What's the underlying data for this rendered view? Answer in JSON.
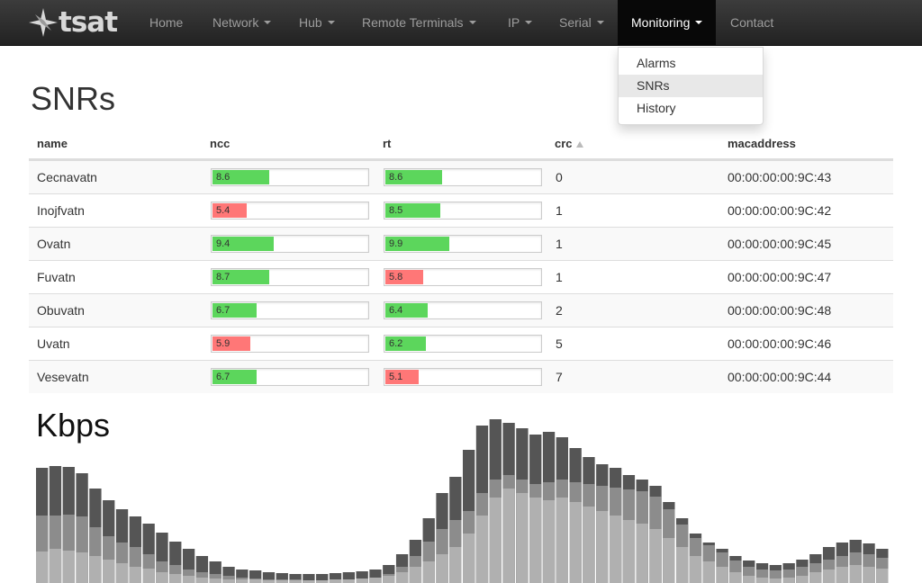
{
  "navbar": {
    "brand": "tsat",
    "items": [
      {
        "label": "Home",
        "caret": false,
        "active": false
      },
      {
        "label": "Network",
        "caret": true,
        "active": false
      },
      {
        "label": "Hub",
        "caret": true,
        "active": false
      },
      {
        "label": "Remote Terminals",
        "caret": true,
        "active": false
      },
      {
        "label": "IP",
        "caret": true,
        "active": false
      },
      {
        "label": "Serial",
        "caret": true,
        "active": false
      },
      {
        "label": "Monitoring",
        "caret": true,
        "active": true
      },
      {
        "label": "Contact",
        "caret": false,
        "active": false
      }
    ],
    "dropdown": [
      {
        "label": "Alarms"
      },
      {
        "label": "SNRs"
      },
      {
        "label": "History"
      }
    ]
  },
  "snr": {
    "title": "SNRs",
    "columns": {
      "name": "name",
      "ncc": "ncc",
      "rt": "rt",
      "crc": "crc",
      "mac": "macaddress"
    },
    "sorted_column": "crc",
    "colors": {
      "ok": "#5cd65c",
      "bad": "#ff7777"
    },
    "rows": [
      {
        "name": "Cecnavatn",
        "ncc": "8.6",
        "ncc_fill": 0.36,
        "ncc_status": "ok",
        "rt": "8.6",
        "rt_fill": 0.36,
        "rt_status": "ok",
        "crc": "0",
        "mac": "00:00:00:00:9C:43"
      },
      {
        "name": "Inojfvatn",
        "ncc": "5.4",
        "ncc_fill": 0.22,
        "ncc_status": "bad",
        "rt": "8.5",
        "rt_fill": 0.35,
        "rt_status": "ok",
        "crc": "1",
        "mac": "00:00:00:00:9C:42"
      },
      {
        "name": "Ovatn",
        "ncc": "9.4",
        "ncc_fill": 0.39,
        "ncc_status": "ok",
        "rt": "9.9",
        "rt_fill": 0.41,
        "rt_status": "ok",
        "crc": "1",
        "mac": "00:00:00:00:9C:45"
      },
      {
        "name": "Fuvatn",
        "ncc": "8.7",
        "ncc_fill": 0.36,
        "ncc_status": "ok",
        "rt": "5.8",
        "rt_fill": 0.24,
        "rt_status": "bad",
        "crc": "1",
        "mac": "00:00:00:00:9C:47"
      },
      {
        "name": "Obuvatn",
        "ncc": "6.7",
        "ncc_fill": 0.28,
        "ncc_status": "ok",
        "rt": "6.4",
        "rt_fill": 0.27,
        "rt_status": "ok",
        "crc": "2",
        "mac": "00:00:00:00:9C:48"
      },
      {
        "name": "Uvatn",
        "ncc": "5.9",
        "ncc_fill": 0.24,
        "ncc_status": "bad",
        "rt": "6.2",
        "rt_fill": 0.26,
        "rt_status": "ok",
        "crc": "5",
        "mac": "00:00:00:00:9C:46"
      },
      {
        "name": "Vesevatn",
        "ncc": "6.7",
        "ncc_fill": 0.28,
        "ncc_status": "ok",
        "rt": "5.1",
        "rt_fill": 0.21,
        "rt_status": "bad",
        "crc": "7",
        "mac": "00:00:00:00:9C:44"
      }
    ]
  },
  "chart_data": {
    "type": "bar",
    "title": "Kbps",
    "stacked": true,
    "ylim": [
      0,
      200
    ],
    "colors": [
      "#b0b0b0",
      "#8c8c8c",
      "#555555"
    ],
    "series": [
      {
        "values": [
          35,
          38,
          36,
          34,
          30,
          26,
          22,
          18,
          16,
          12,
          10,
          8,
          6,
          5,
          4,
          4,
          4,
          3,
          3,
          3,
          3,
          3,
          4,
          4,
          5,
          6,
          8,
          12,
          18,
          24,
          32,
          40,
          55,
          75,
          95,
          105,
          100,
          95,
          92,
          95,
          90,
          85,
          80,
          75,
          70,
          66,
          60,
          50,
          40,
          30,
          24,
          18,
          12,
          8,
          6,
          5,
          6,
          8,
          12,
          15,
          18,
          20,
          18,
          16
        ]
      },
      {
        "values": [
          75,
          75,
          76,
          74,
          62,
          52,
          45,
          40,
          32,
          24,
          20,
          15,
          12,
          10,
          8,
          6,
          5,
          4,
          4,
          4,
          3,
          3,
          4,
          4,
          5,
          6,
          10,
          18,
          30,
          46,
          60,
          70,
          80,
          100,
          115,
          120,
          115,
          110,
          112,
          115,
          112,
          110,
          108,
          106,
          104,
          102,
          96,
          82,
          65,
          50,
          42,
          34,
          25,
          18,
          15,
          14,
          15,
          18,
          22,
          26,
          30,
          34,
          32,
          28
        ]
      },
      {
        "values": [
          128,
          130,
          129,
          122,
          105,
          92,
          82,
          74,
          66,
          56,
          46,
          38,
          30,
          24,
          18,
          15,
          14,
          12,
          11,
          10,
          10,
          10,
          11,
          12,
          13,
          15,
          20,
          32,
          48,
          72,
          100,
          118,
          148,
          175,
          182,
          178,
          172,
          165,
          168,
          162,
          150,
          140,
          132,
          128,
          120,
          115,
          108,
          90,
          72,
          55,
          45,
          38,
          30,
          25,
          22,
          20,
          22,
          26,
          32,
          40,
          45,
          48,
          44,
          38
        ]
      }
    ]
  }
}
